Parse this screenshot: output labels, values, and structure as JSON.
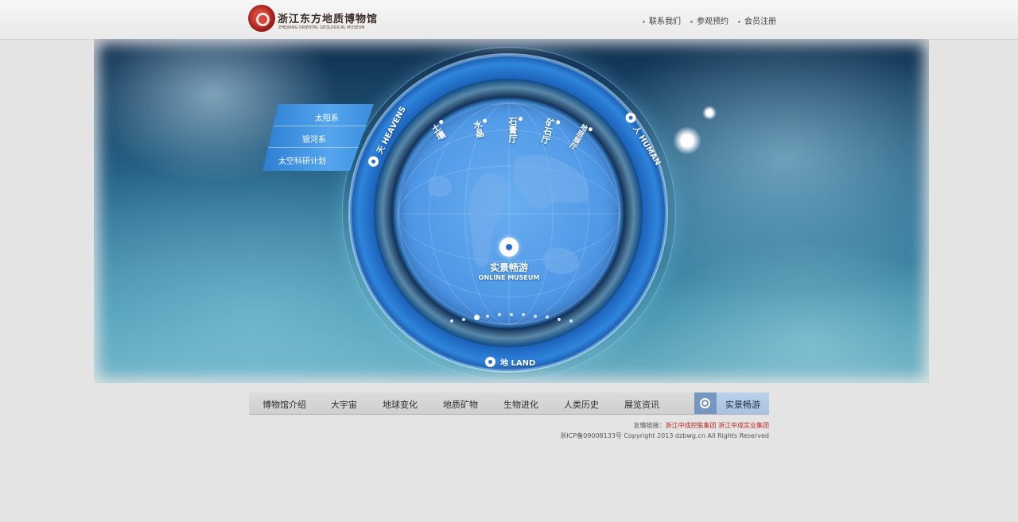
{
  "header": {
    "logo_cn": "浙江东方地质博物馆",
    "logo_en": "ZHEJIANG ORIENTAL GEOLOGICAL MUSEUM",
    "links": [
      "联系我们",
      "参观预约",
      "会员注册"
    ]
  },
  "banner": {
    "submenu": [
      "太阳系",
      "银河系",
      "太空科研计划"
    ],
    "ring_labels": {
      "heavens": "天 HEAVENS",
      "human": "人 HUMAN",
      "land": "地 LAND"
    },
    "globe_labels": [
      "土壤",
      "水晶",
      "石膏厅",
      "矿石厅",
      "地层展厅"
    ],
    "center_title": "实景畅游",
    "center_sub": "ONLINE MUSEUM",
    "pager_active": 2,
    "pager_total": 11
  },
  "nav": {
    "items": [
      "博物馆介绍",
      "大宇宙",
      "地球变化",
      "地质矿物",
      "生物进化",
      "人类历史",
      "展览资讯"
    ],
    "live": "实景畅游"
  },
  "footer": {
    "links_label": "友情链接：",
    "link1": "浙江中成控股集团",
    "link2": "浙江中成实业集团",
    "copyright": "浙ICP备09008133号 Copyright 2013 dzbwg.cn All Rights Reserved"
  },
  "colors": {
    "ring_blue": "#2f85dc",
    "globe_blue": "#4f98e6",
    "footer_link_red": "#b9251f"
  }
}
